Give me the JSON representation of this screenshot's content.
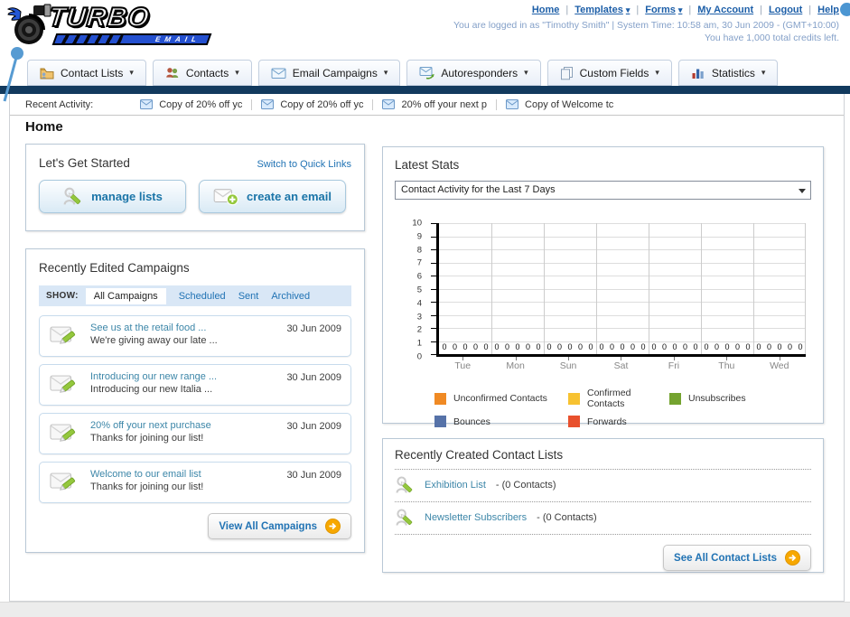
{
  "header": {
    "logo": {
      "title": "TURBO",
      "subtitle": "EMAIL"
    },
    "nav": [
      {
        "label": "Home",
        "dropdown": false
      },
      {
        "label": "Templates",
        "dropdown": true
      },
      {
        "label": "Forms",
        "dropdown": true
      },
      {
        "label": "My Account",
        "dropdown": false
      },
      {
        "label": "Logout",
        "dropdown": false
      },
      {
        "label": "Help",
        "dropdown": false
      }
    ],
    "login_info": "You are logged in as \"Timothy Smith\" | System Time: 10:58 am, 30 Jun 2009 - (GMT+10:00)",
    "credits_info": "You have 1,000 total credits left."
  },
  "tabs": [
    {
      "label": "Contact Lists"
    },
    {
      "label": "Contacts"
    },
    {
      "label": "Email Campaigns"
    },
    {
      "label": "Autoresponders"
    },
    {
      "label": "Custom Fields"
    },
    {
      "label": "Statistics"
    }
  ],
  "recent_activity": {
    "label": "Recent Activity:",
    "items": [
      "Copy of 20% off yc",
      "Copy of 20% off yc",
      "20% off your next p",
      "Copy of Welcome tc"
    ]
  },
  "page_title": "Home",
  "get_started": {
    "title": "Let's Get Started",
    "switch_link": "Switch to Quick Links",
    "manage_lists_label": "manage lists",
    "create_email_label": "create an email"
  },
  "campaigns": {
    "title": "Recently Edited Campaigns",
    "show_label": "SHOW:",
    "filters": [
      "All Campaigns",
      "Scheduled",
      "Sent",
      "Archived"
    ],
    "active_filter": "All Campaigns",
    "items": [
      {
        "title": "See us at the retail food ...",
        "subtitle": "We're giving away our late ...",
        "date": "30 Jun 2009"
      },
      {
        "title": "Introducing our new range ...",
        "subtitle": "Introducing our new Italia ...",
        "date": "30 Jun 2009"
      },
      {
        "title": "20% off your next purchase",
        "subtitle": "Thanks for joining our list!",
        "date": "30 Jun 2009"
      },
      {
        "title": "Welcome to our email list",
        "subtitle": "Thanks for joining our list!",
        "date": "30 Jun 2009"
      }
    ],
    "view_all_label": "View All Campaigns"
  },
  "stats": {
    "title": "Latest Stats",
    "dropdown_value": "Contact Activity for the Last 7 Days"
  },
  "chart_data": {
    "type": "bar",
    "title": "Contact Activity for the Last 7 Days",
    "categories": [
      "Tue",
      "Mon",
      "Sun",
      "Sat",
      "Fri",
      "Thu",
      "Wed"
    ],
    "series": [
      {
        "name": "Unconfirmed Contacts",
        "color": "#f08a24",
        "values": [
          0,
          0,
          0,
          0,
          0,
          0,
          0
        ]
      },
      {
        "name": "Confirmed Contacts",
        "color": "#f7c231",
        "values": [
          0,
          0,
          0,
          0,
          0,
          0,
          0
        ]
      },
      {
        "name": "Unsubscribes",
        "color": "#74a32f",
        "values": [
          0,
          0,
          0,
          0,
          0,
          0,
          0
        ]
      },
      {
        "name": "Bounces",
        "color": "#5672a8",
        "values": [
          0,
          0,
          0,
          0,
          0,
          0,
          0
        ]
      },
      {
        "name": "Forwards",
        "color": "#e8502d",
        "values": [
          0,
          0,
          0,
          0,
          0,
          0,
          0
        ]
      }
    ],
    "xlabel": "",
    "ylabel": "",
    "ylim": [
      0,
      10
    ],
    "ytick_step": 1,
    "grid": true,
    "legend_position": "bottom"
  },
  "contact_lists": {
    "title": "Recently Created Contact Lists",
    "items": [
      {
        "name": "Exhibition List",
        "detail": "- (0 Contacts)"
      },
      {
        "name": "Newsletter Subscribers",
        "detail": "- (0 Contacts)"
      }
    ],
    "see_all_label": "See All Contact Lists"
  }
}
